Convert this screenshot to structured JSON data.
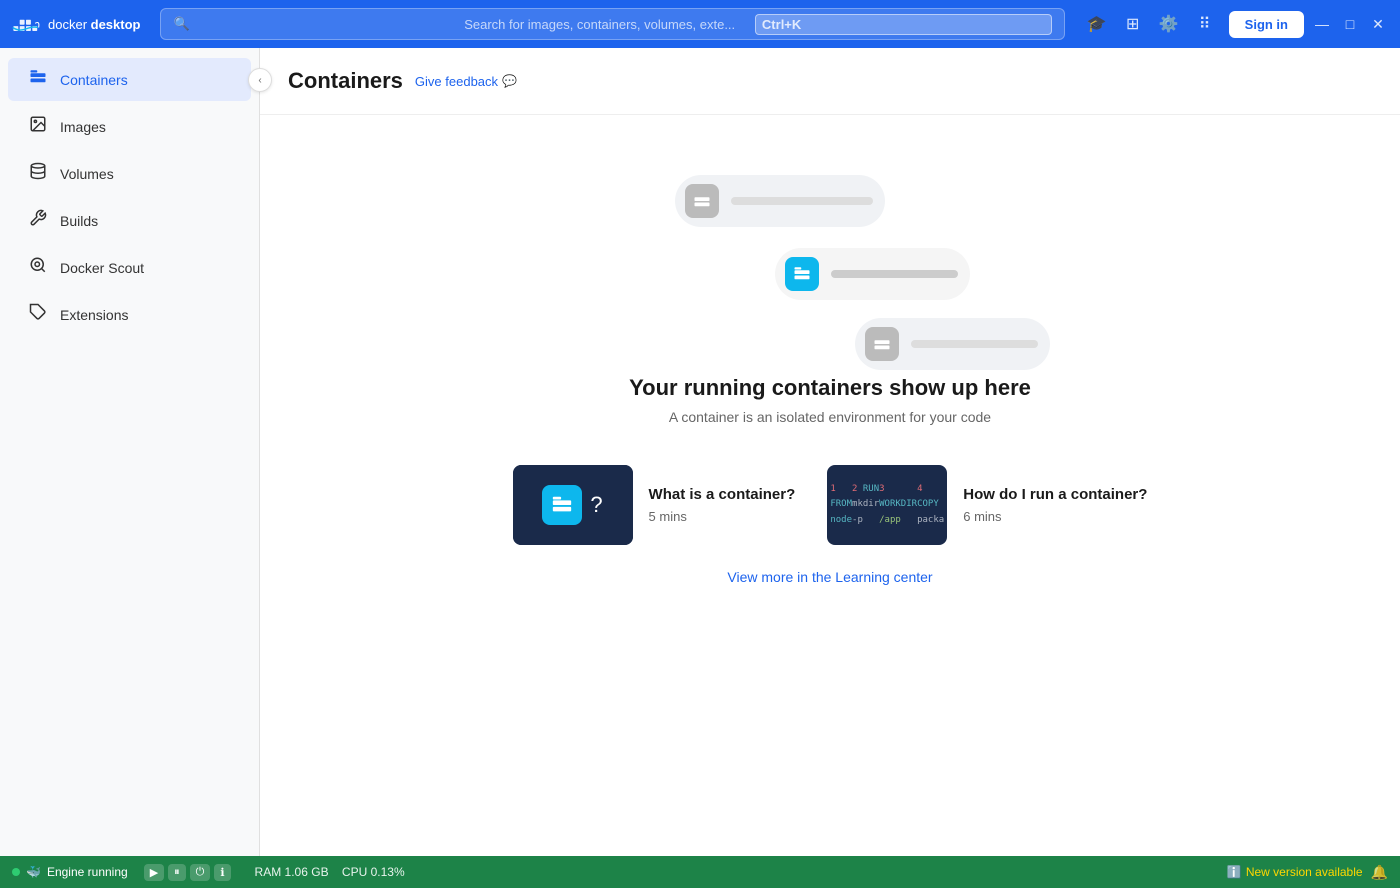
{
  "titlebar": {
    "app_name": "docker desktop",
    "search_placeholder": "Search for images, containers, volumes, exte...",
    "shortcut": "Ctrl+K",
    "sign_in_label": "Sign in"
  },
  "sidebar": {
    "items": [
      {
        "id": "containers",
        "label": "Containers",
        "icon": "📦",
        "active": true
      },
      {
        "id": "images",
        "label": "Images",
        "icon": "🖼️",
        "active": false
      },
      {
        "id": "volumes",
        "label": "Volumes",
        "icon": "🗄️",
        "active": false
      },
      {
        "id": "builds",
        "label": "Builds",
        "icon": "🔧",
        "active": false
      },
      {
        "id": "docker-scout",
        "label": "Docker Scout",
        "icon": "🎯",
        "active": false
      },
      {
        "id": "extensions",
        "label": "Extensions",
        "icon": "🧩",
        "active": false
      }
    ]
  },
  "header": {
    "title": "Containers",
    "feedback_label": "Give feedback",
    "feedback_icon": "💬"
  },
  "empty_state": {
    "title": "Your running containers show up here",
    "subtitle": "A container is an isolated environment for your code"
  },
  "cards": [
    {
      "id": "what-is-container",
      "title": "What is a container?",
      "duration": "5 mins",
      "type": "icon"
    },
    {
      "id": "how-run-container",
      "title": "How do I run a container?",
      "duration": "6 mins",
      "type": "code"
    }
  ],
  "code_snippet": {
    "line1": "FROM node",
    "line2": "RUN mkdir -p",
    "line3": "WORKDIR /app",
    "line4": "COPY packa"
  },
  "learning_center": {
    "label": "View more in the Learning center"
  },
  "statusbar": {
    "engine_label": "Engine running",
    "ram_label": "RAM 1.06 GB",
    "cpu_label": "CPU 0.13%",
    "new_version_label": "New version available"
  },
  "window_controls": {
    "minimize": "—",
    "maximize": "□",
    "close": "✕"
  }
}
